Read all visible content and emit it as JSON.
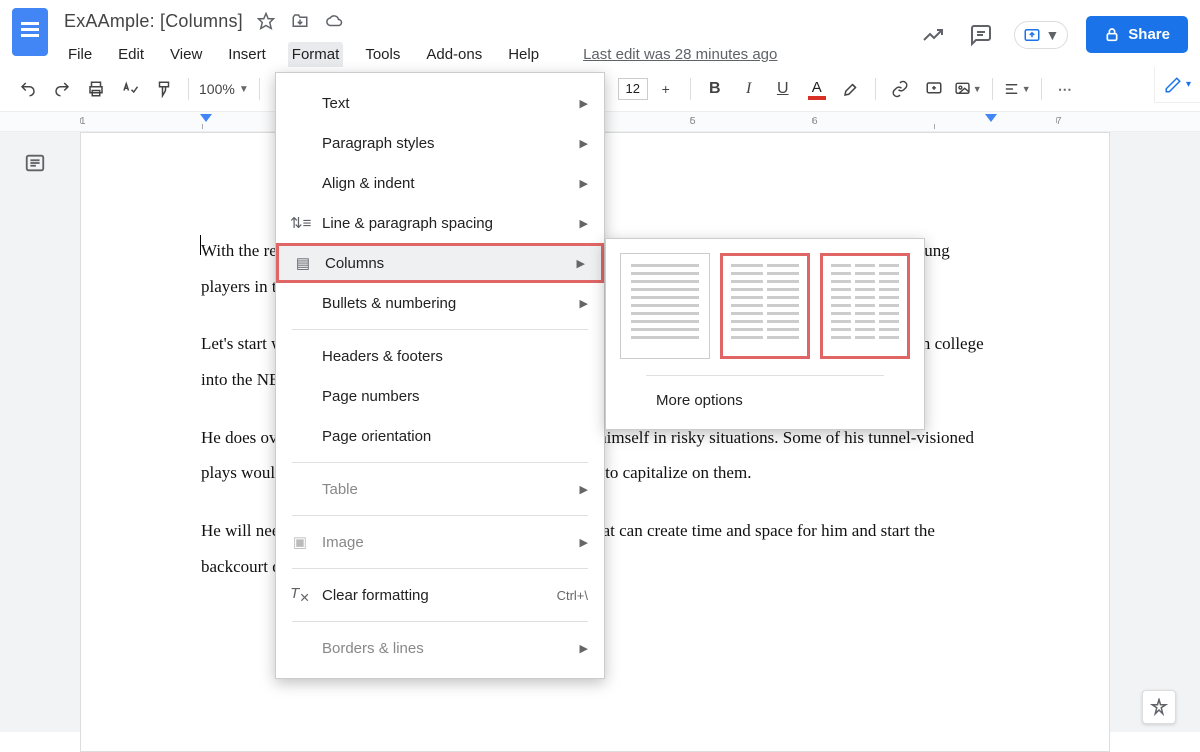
{
  "title": "ExAAmple: [Columns]",
  "menubar": [
    "File",
    "Edit",
    "View",
    "Insert",
    "Format",
    "Tools",
    "Add-ons",
    "Help"
  ],
  "last_edit": "Last edit was 28 minutes ago",
  "share_label": "Share",
  "zoom": "100%",
  "font_size": "12",
  "ruler_ticks": [
    "1",
    "",
    "",
    "",
    "",
    "5",
    "6",
    "",
    "7"
  ],
  "format_menu": {
    "items": [
      {
        "label": "Text",
        "arrow": true
      },
      {
        "label": "Paragraph styles",
        "arrow": true
      },
      {
        "label": "Align & indent",
        "arrow": true
      },
      {
        "label": "Line & paragraph spacing",
        "arrow": true,
        "icon": "line-spacing"
      },
      {
        "label": "Columns",
        "arrow": true,
        "icon": "columns",
        "highlight": true
      },
      {
        "label": "Bullets & numbering",
        "arrow": true
      },
      {
        "sep": true
      },
      {
        "label": "Headers & footers"
      },
      {
        "label": "Page numbers"
      },
      {
        "label": "Page orientation"
      },
      {
        "sep": true
      },
      {
        "label": "Table",
        "arrow": true,
        "dim": true
      },
      {
        "sep": true
      },
      {
        "label": "Image",
        "arrow": true,
        "dim": true,
        "icon": "image"
      },
      {
        "sep": true
      },
      {
        "label": "Clear formatting",
        "icon": "clear-format",
        "shortcut": "Ctrl+\\"
      },
      {
        "sep": true
      },
      {
        "label": "Borders & lines",
        "arrow": true,
        "dim": true
      }
    ]
  },
  "columns_submenu": {
    "options": [
      1,
      2,
      3
    ],
    "more": "More options"
  },
  "doc_body": {
    "p1": "With the release of NBA 2K17 from 2K games, I figured I'd compile some notes for one of my favorite young players in the Association.",
    "p2": "Let's start with his pure scoring potential; there's lots of ideas of how effective he'll be in transitioning from college into the NBA.",
    "p3": "He does over-dribble from time to time, and can often put himself in risky situations. Some of his tunnel-visioned plays would seem very low percentage, but he has the skill to capitalize on them.",
    "p4": "He will need some help defensively, perhaps a big guard that can create time and space for him and start the backcourt defense."
  }
}
